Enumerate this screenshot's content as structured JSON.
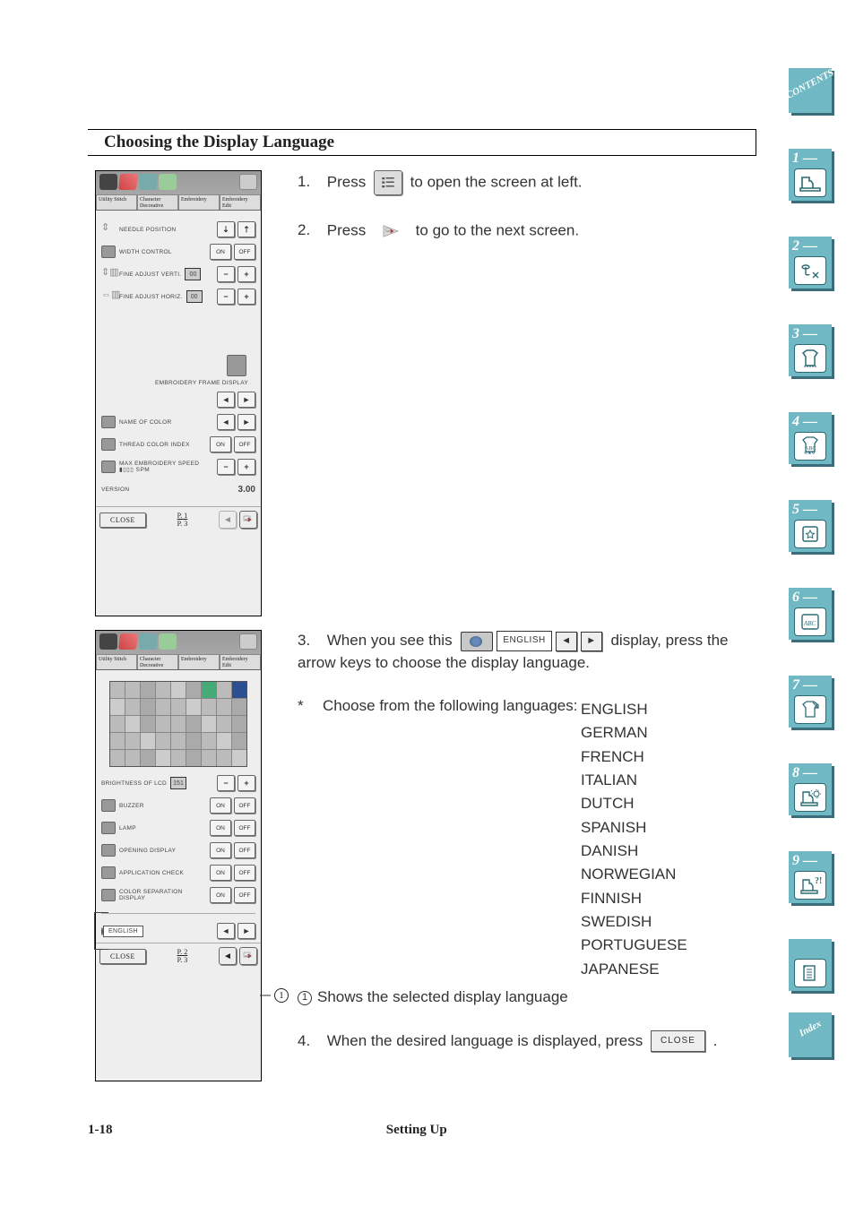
{
  "section_title": "Choosing the Display Language",
  "steps": {
    "s1_pre": "Press",
    "s1_post": "to open the screen at left.",
    "s2_pre": "Press",
    "s2_post": "to go to the next screen.",
    "s3_pre": "When you see this",
    "s3_post": "display, press the arrow keys to choose the display language.",
    "star_note": "Choose from the following languages:",
    "callout1": "Shows the selected display language",
    "s4_pre": "When the desired language is displayed, press",
    "s4_post": "."
  },
  "languages": [
    "ENGLISH",
    "GERMAN",
    "FRENCH",
    "ITALIAN",
    "DUTCH",
    "SPANISH",
    "DANISH",
    "NORWEGIAN",
    "FINNISH",
    "SWEDISH",
    "PORTUGUESE",
    "JAPANESE"
  ],
  "screen1": {
    "tabs": [
      "Utility Stitch",
      "Character Decorative Stitch",
      "Embroidery",
      "Embroidery Edit"
    ],
    "rows": {
      "needle": "NEEDLE POSITION",
      "width": "WIDTH CONTROL",
      "fav": "FINE ADJUST VERTI.",
      "fah": "FINE ADJUST HORIZ.",
      "efd": "EMBROIDERY FRAME DISPLAY",
      "nameofcolor": "NAME OF COLOR",
      "tci": "THREAD COLOR INDEX",
      "mes": "MAX EMBROIDERY SPEED",
      "spm": "SPM",
      "version_lbl": "VERSION",
      "version_val": "3.00",
      "on": "ON",
      "off": "OFF"
    },
    "close": "CLOSE",
    "page_top": "P. 1",
    "page_bot": "P. 3"
  },
  "screen2": {
    "rows": {
      "bright": "BRIGHTNESS OF LCD",
      "bright_val": "151",
      "buzzer": "BUZZER",
      "lamp": "LAMP",
      "opening": "OPENING DISPLAY",
      "appcheck": "APPLICATION CHECK",
      "colorsep": "COLOR SEPARATION DISPLAY",
      "on": "ON",
      "off": "OFF",
      "lang": "ENGLISH"
    },
    "close": "CLOSE",
    "page_top": "P. 2",
    "page_bot": "P. 3"
  },
  "inline": {
    "english": "ENGLISH",
    "close": "CLOSE"
  },
  "footer": {
    "page": "1-18",
    "chapter": "Setting Up"
  },
  "tabs": {
    "contents": "CONTENTS",
    "index": "Index",
    "n": [
      "1 —",
      "2 —",
      "3 —",
      "4 —",
      "5 —",
      "6 —",
      "7 —",
      "8 —",
      "9 —"
    ]
  }
}
